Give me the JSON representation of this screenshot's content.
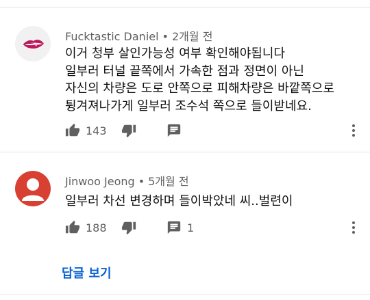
{
  "comments": [
    {
      "author": "Fucktastic Daniel",
      "time": "2개월 전",
      "lines": [
        "이거 청부 살인가능성 여부 확인해야됩니다",
        "일부러 터널 끝쪽에서 가속한 점과 정면이 아닌",
        "자신의 차량은 도로 안쪽으로 피해차량은 바깥쪽으로",
        "튕겨져나가게 일부러 조수석 쪽으로 들이받네요."
      ],
      "likes": "143",
      "replies": ""
    },
    {
      "author": "Jinwoo Jeong",
      "time": "5개월 전",
      "lines": [
        "일부러 차선 변경하며 들이박았네 씨..벌련이"
      ],
      "likes": "188",
      "replies": "1"
    }
  ],
  "separator": "•",
  "view_replies_label": "답글 보기",
  "colors": {
    "link": "#065fd4",
    "avatar_default": "#d84132",
    "meta": "#606060"
  }
}
